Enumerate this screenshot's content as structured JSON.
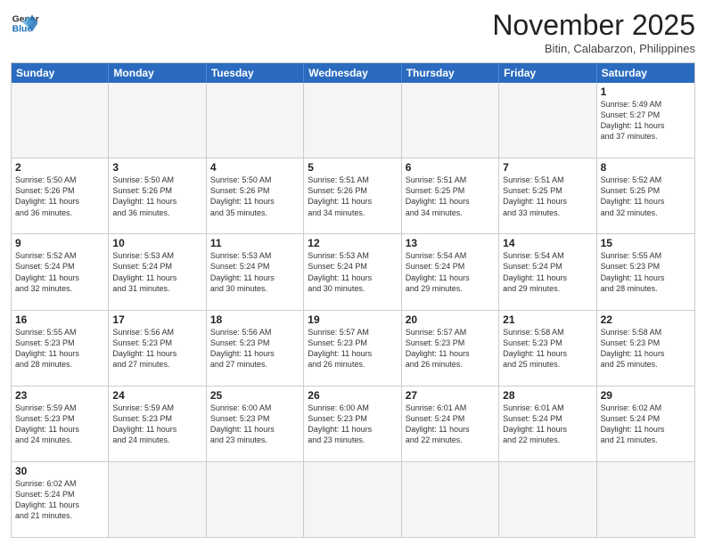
{
  "header": {
    "logo_general": "General",
    "logo_blue": "Blue",
    "month_title": "November 2025",
    "location": "Bitin, Calabarzon, Philippines"
  },
  "weekdays": [
    "Sunday",
    "Monday",
    "Tuesday",
    "Wednesday",
    "Thursday",
    "Friday",
    "Saturday"
  ],
  "rows": [
    [
      {
        "day": "",
        "info": ""
      },
      {
        "day": "",
        "info": ""
      },
      {
        "day": "",
        "info": ""
      },
      {
        "day": "",
        "info": ""
      },
      {
        "day": "",
        "info": ""
      },
      {
        "day": "",
        "info": ""
      },
      {
        "day": "1",
        "info": "Sunrise: 5:49 AM\nSunset: 5:27 PM\nDaylight: 11 hours\nand 37 minutes."
      }
    ],
    [
      {
        "day": "2",
        "info": "Sunrise: 5:50 AM\nSunset: 5:26 PM\nDaylight: 11 hours\nand 36 minutes."
      },
      {
        "day": "3",
        "info": "Sunrise: 5:50 AM\nSunset: 5:26 PM\nDaylight: 11 hours\nand 36 minutes."
      },
      {
        "day": "4",
        "info": "Sunrise: 5:50 AM\nSunset: 5:26 PM\nDaylight: 11 hours\nand 35 minutes."
      },
      {
        "day": "5",
        "info": "Sunrise: 5:51 AM\nSunset: 5:26 PM\nDaylight: 11 hours\nand 34 minutes."
      },
      {
        "day": "6",
        "info": "Sunrise: 5:51 AM\nSunset: 5:25 PM\nDaylight: 11 hours\nand 34 minutes."
      },
      {
        "day": "7",
        "info": "Sunrise: 5:51 AM\nSunset: 5:25 PM\nDaylight: 11 hours\nand 33 minutes."
      },
      {
        "day": "8",
        "info": "Sunrise: 5:52 AM\nSunset: 5:25 PM\nDaylight: 11 hours\nand 32 minutes."
      }
    ],
    [
      {
        "day": "9",
        "info": "Sunrise: 5:52 AM\nSunset: 5:24 PM\nDaylight: 11 hours\nand 32 minutes."
      },
      {
        "day": "10",
        "info": "Sunrise: 5:53 AM\nSunset: 5:24 PM\nDaylight: 11 hours\nand 31 minutes."
      },
      {
        "day": "11",
        "info": "Sunrise: 5:53 AM\nSunset: 5:24 PM\nDaylight: 11 hours\nand 30 minutes."
      },
      {
        "day": "12",
        "info": "Sunrise: 5:53 AM\nSunset: 5:24 PM\nDaylight: 11 hours\nand 30 minutes."
      },
      {
        "day": "13",
        "info": "Sunrise: 5:54 AM\nSunset: 5:24 PM\nDaylight: 11 hours\nand 29 minutes."
      },
      {
        "day": "14",
        "info": "Sunrise: 5:54 AM\nSunset: 5:24 PM\nDaylight: 11 hours\nand 29 minutes."
      },
      {
        "day": "15",
        "info": "Sunrise: 5:55 AM\nSunset: 5:23 PM\nDaylight: 11 hours\nand 28 minutes."
      }
    ],
    [
      {
        "day": "16",
        "info": "Sunrise: 5:55 AM\nSunset: 5:23 PM\nDaylight: 11 hours\nand 28 minutes."
      },
      {
        "day": "17",
        "info": "Sunrise: 5:56 AM\nSunset: 5:23 PM\nDaylight: 11 hours\nand 27 minutes."
      },
      {
        "day": "18",
        "info": "Sunrise: 5:56 AM\nSunset: 5:23 PM\nDaylight: 11 hours\nand 27 minutes."
      },
      {
        "day": "19",
        "info": "Sunrise: 5:57 AM\nSunset: 5:23 PM\nDaylight: 11 hours\nand 26 minutes."
      },
      {
        "day": "20",
        "info": "Sunrise: 5:57 AM\nSunset: 5:23 PM\nDaylight: 11 hours\nand 26 minutes."
      },
      {
        "day": "21",
        "info": "Sunrise: 5:58 AM\nSunset: 5:23 PM\nDaylight: 11 hours\nand 25 minutes."
      },
      {
        "day": "22",
        "info": "Sunrise: 5:58 AM\nSunset: 5:23 PM\nDaylight: 11 hours\nand 25 minutes."
      }
    ],
    [
      {
        "day": "23",
        "info": "Sunrise: 5:59 AM\nSunset: 5:23 PM\nDaylight: 11 hours\nand 24 minutes."
      },
      {
        "day": "24",
        "info": "Sunrise: 5:59 AM\nSunset: 5:23 PM\nDaylight: 11 hours\nand 24 minutes."
      },
      {
        "day": "25",
        "info": "Sunrise: 6:00 AM\nSunset: 5:23 PM\nDaylight: 11 hours\nand 23 minutes."
      },
      {
        "day": "26",
        "info": "Sunrise: 6:00 AM\nSunset: 5:23 PM\nDaylight: 11 hours\nand 23 minutes."
      },
      {
        "day": "27",
        "info": "Sunrise: 6:01 AM\nSunset: 5:24 PM\nDaylight: 11 hours\nand 22 minutes."
      },
      {
        "day": "28",
        "info": "Sunrise: 6:01 AM\nSunset: 5:24 PM\nDaylight: 11 hours\nand 22 minutes."
      },
      {
        "day": "29",
        "info": "Sunrise: 6:02 AM\nSunset: 5:24 PM\nDaylight: 11 hours\nand 21 minutes."
      }
    ],
    [
      {
        "day": "30",
        "info": "Sunrise: 6:02 AM\nSunset: 5:24 PM\nDaylight: 11 hours\nand 21 minutes."
      },
      {
        "day": "",
        "info": ""
      },
      {
        "day": "",
        "info": ""
      },
      {
        "day": "",
        "info": ""
      },
      {
        "day": "",
        "info": ""
      },
      {
        "day": "",
        "info": ""
      },
      {
        "day": "",
        "info": ""
      }
    ]
  ]
}
